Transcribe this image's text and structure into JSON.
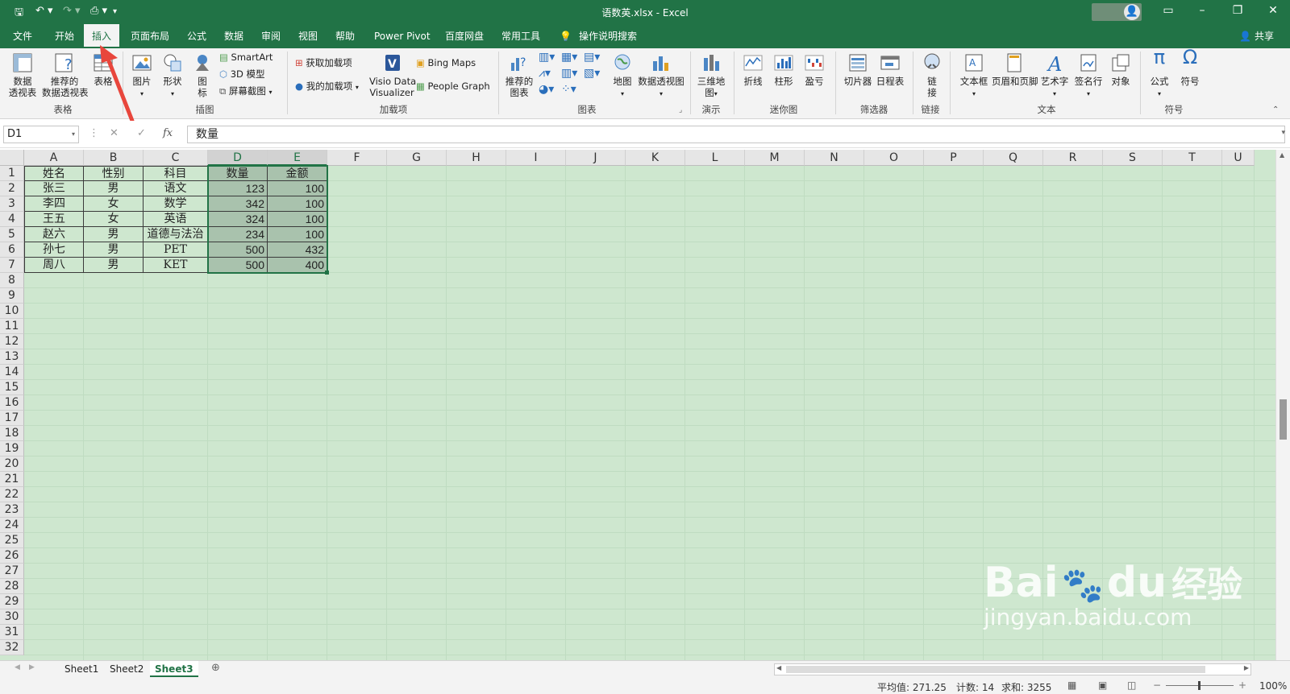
{
  "titlebar": {
    "doc_title": "语数英.xlsx - Excel",
    "save_icon": "save-icon",
    "undo_icon": "undo-icon",
    "redo_icon": "redo-icon",
    "print_preview_icon": "print-preview-icon",
    "customize_icon": "customize-qat-icon",
    "ribbon_display_icon": "ribbon-display-icon",
    "minimize": "–",
    "restore": "❐",
    "close": "✕"
  },
  "tabs": [
    "文件",
    "开始",
    "插入",
    "页面布局",
    "公式",
    "数据",
    "审阅",
    "视图",
    "帮助",
    "Power Pivot",
    "百度网盘",
    "常用工具",
    "操作说明搜索"
  ],
  "active_tab": "插入",
  "share_label": "共享",
  "ribbon": {
    "table_group": {
      "label": "表格",
      "pivot": "数据\n透视表",
      "recommended_pivot": "推荐的\n数据透视表",
      "table": "表格"
    },
    "illustrations_group": {
      "label": "插图",
      "picture": "图片",
      "shapes": "形状",
      "icons": "图\n标",
      "smartart": "SmartArt",
      "model3d": "3D 模型",
      "screenshot": "屏幕截图"
    },
    "addins_group": {
      "label": "加载项",
      "get_addins": "获取加载项",
      "my_addins": "我的加载项",
      "visio": "Visio Data\nVisualizer",
      "bing_maps": "Bing Maps",
      "people_graph": "People Graph"
    },
    "charts_group": {
      "label": "图表",
      "recommended": "推荐的\n图表",
      "map": "地图",
      "pivot_chart": "数据透视图"
    },
    "tours_group": {
      "label": "演示",
      "map3d": "三维地\n图"
    },
    "sparklines_group": {
      "label": "迷你图",
      "line": "折线",
      "column": "柱形",
      "winloss": "盈亏"
    },
    "filters_group": {
      "label": "筛选器",
      "slicer": "切片器",
      "timeline": "日程表"
    },
    "links_group": {
      "label": "链接",
      "link": "链\n接"
    },
    "text_group": {
      "label": "文本",
      "textbox": "文本框",
      "header_footer": "页眉和页脚",
      "wordart": "艺术字",
      "signature": "签名行",
      "object": "对象"
    },
    "symbols_group": {
      "label": "符号",
      "equation": "公式",
      "symbol": "符号"
    }
  },
  "formula_bar": {
    "name_box": "D1",
    "fx": "fx",
    "cancel": "✕",
    "enter": "✓",
    "content": "数量"
  },
  "columns": [
    "A",
    "B",
    "C",
    "D",
    "E",
    "F",
    "G",
    "H",
    "I",
    "J",
    "K",
    "L",
    "M",
    "N",
    "O",
    "P",
    "Q",
    "R",
    "S",
    "T",
    "U"
  ],
  "rows": [
    "1",
    "2",
    "3",
    "4",
    "5",
    "6",
    "7",
    "8",
    "9",
    "10",
    "11",
    "12",
    "13",
    "14",
    "15",
    "16",
    "17",
    "18",
    "19",
    "20",
    "21",
    "22",
    "23",
    "24",
    "25",
    "26",
    "27",
    "28",
    "29",
    "30",
    "31",
    "32"
  ],
  "table": {
    "headers": [
      "姓名",
      "性别",
      "科目",
      "数量",
      "金额"
    ],
    "data": [
      [
        "张三",
        "男",
        "语文",
        "123",
        "100"
      ],
      [
        "李四",
        "女",
        "数学",
        "342",
        "100"
      ],
      [
        "王五",
        "女",
        "英语",
        "324",
        "100"
      ],
      [
        "赵六",
        "男",
        "道德与法治",
        "234",
        "100"
      ],
      [
        "孙七",
        "男",
        "PET",
        "500",
        "432"
      ],
      [
        "周八",
        "男",
        "KET",
        "500",
        "400"
      ]
    ]
  },
  "sheets": [
    "Sheet1",
    "Sheet2",
    "Sheet3"
  ],
  "active_sheet": "Sheet3",
  "status": {
    "average": "平均值: 271.25",
    "count": "计数: 14",
    "sum": "求和: 3255",
    "zoom": "100%"
  },
  "watermark": {
    "brand": "Bai",
    "brand2": "du",
    "cn": "经验",
    "url": "jingyan.baidu.com"
  },
  "colors": {
    "excel_green": "#217346",
    "sheet_bg": "#cee7cf",
    "selection": "#a9c2ad",
    "arrow": "#e8463c"
  }
}
